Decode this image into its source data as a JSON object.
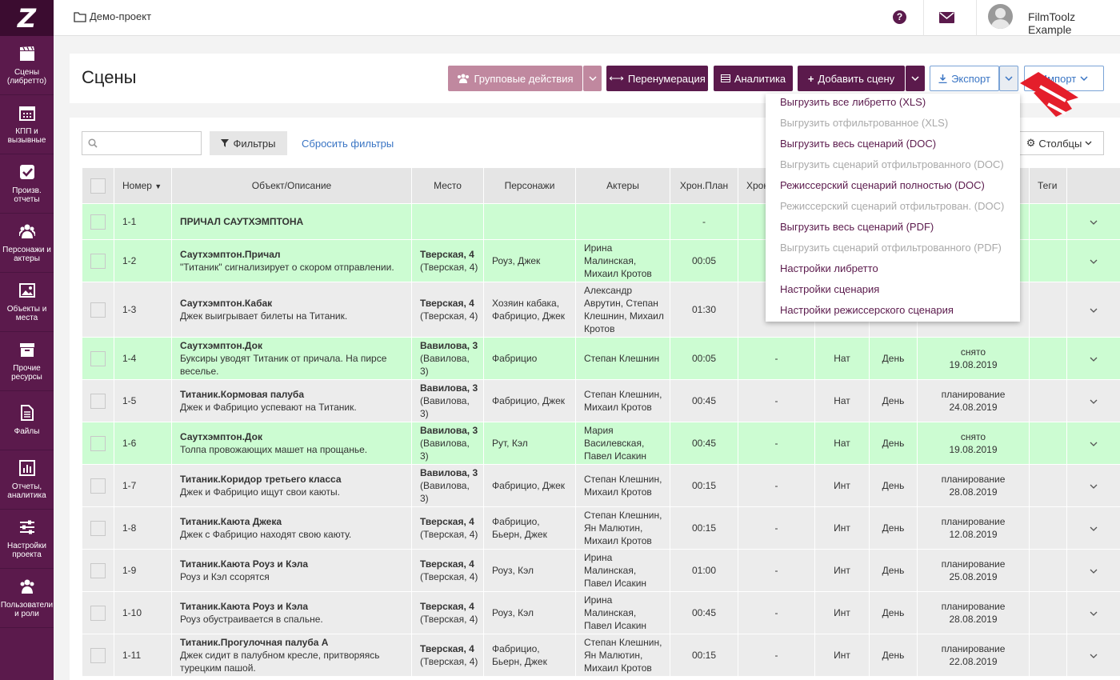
{
  "app": {
    "logo": "Z"
  },
  "sidebar": {
    "items": [
      {
        "label": "Сцены (либретто)",
        "icon": "clapperboard-icon"
      },
      {
        "label": "КПП и вызывные",
        "icon": "calendar-icon"
      },
      {
        "label": "Произв. отчеты",
        "icon": "checkbox-icon"
      },
      {
        "label": "Персонажи и актеры",
        "icon": "people-icon"
      },
      {
        "label": "Объекты и места",
        "icon": "image-icon"
      },
      {
        "label": "Прочие ресурсы",
        "icon": "archive-icon"
      },
      {
        "label": "Файлы",
        "icon": "file-icon"
      },
      {
        "label": "Отчеты, аналитика",
        "icon": "bar-chart-icon"
      },
      {
        "label": "Настройки проекта",
        "icon": "sliders-icon"
      },
      {
        "label": "Пользователи и роли",
        "icon": "users-icon"
      }
    ]
  },
  "topbar": {
    "project": "Демо-проект",
    "help": "?",
    "user": "FilmToolz Example"
  },
  "header": {
    "title": "Сцены",
    "group_actions": "Групповые действия",
    "renumber": "Перенумерация",
    "analytics": "Аналитика",
    "add_scene": "Добавить сцену",
    "export": "Экспорт",
    "import": "Импорт"
  },
  "toolbar": {
    "filters": "Фильтры",
    "reset": "Сбросить фильтры",
    "columns": "Столбцы"
  },
  "table": {
    "headers": {
      "num": "Номер",
      "obj": "Объект/Описание",
      "place": "Место",
      "chars": "Персонажи",
      "actors": "Актеры",
      "chron": "Хрон.План",
      "chron2": "Хрон",
      "tags": "Теги"
    },
    "rows": [
      {
        "num": "1-1",
        "title": "ПРИЧАЛ САУТХЭМПТОНА",
        "desc": "",
        "place_b": "",
        "place": "",
        "chars": "",
        "actors": "",
        "chron": "-",
        "chron2": "",
        "it": "",
        "dn": "",
        "status": "",
        "date": "",
        "green": true
      },
      {
        "num": "1-2",
        "title": "Саутхэмптон.Причал",
        "desc": "\"Титаник\" сигнализирует о скором отправлении.",
        "place_b": "Тверская, 4",
        "place": "(Тверская, 4)",
        "chars": "Роуз, Джек",
        "actors": "Ирина Малинская, Михаил Кротов",
        "chron": "00:05",
        "chron2": "",
        "it": "",
        "dn": "",
        "status": "",
        "date": "",
        "green": true
      },
      {
        "num": "1-3",
        "title": "Саутхэмптон.Кабак",
        "desc": "Джек выигрывает билеты на Титаник.",
        "place_b": "Тверская, 4",
        "place": "(Тверская, 4)",
        "chars": "Хозяин кабака, Фабрицио, Джек",
        "actors": "Александр Аврутин, Степан Клешнин, Михаил Кротов",
        "chron": "01:30",
        "chron2": "",
        "it": "",
        "dn": "",
        "status": "",
        "date": "",
        "green": false
      },
      {
        "num": "1-4",
        "title": "Саутхэмптон.Док",
        "desc": "Буксиры уводят Титаник от причала. На пирсе веселье.",
        "place_b": "Вавилова, 3",
        "place": "(Вавилова, 3)",
        "chars": "Фабрицио",
        "actors": "Степан Клешнин",
        "chron": "00:05",
        "chron2": "-",
        "it": "Нат",
        "dn": "День",
        "status": "снято",
        "date": "19.08.2019",
        "green": true
      },
      {
        "num": "1-5",
        "title": "Титаник.Кормовая палуба",
        "desc": "Джек и Фабрицио успевают на Титаник.",
        "place_b": "Вавилова, 3",
        "place": "(Вавилова, 3)",
        "chars": "Фабрицио, Джек",
        "actors": "Степан Клешнин, Михаил Кротов",
        "chron": "00:45",
        "chron2": "-",
        "it": "Нат",
        "dn": "День",
        "status": "планирование",
        "date": "24.08.2019",
        "green": false
      },
      {
        "num": "1-6",
        "title": "Саутхэмптон.Док",
        "desc": "Толпа провожающих машет на прощанье.",
        "place_b": "Вавилова, 3",
        "place": "(Вавилова, 3)",
        "chars": "Рут, Кэл",
        "actors": "Мария Василевская, Павел Исакин",
        "chron": "00:45",
        "chron2": "-",
        "it": "Нат",
        "dn": "День",
        "status": "снято",
        "date": "19.08.2019",
        "green": true
      },
      {
        "num": "1-7",
        "title": "Титаник.Коридор третьего класса",
        "desc": "Джек и Фабрицио ищут свои каюты.",
        "place_b": "Вавилова, 3",
        "place": "(Вавилова, 3)",
        "chars": "Фабрицио, Джек",
        "actors": "Степан Клешнин, Михаил Кротов",
        "chron": "00:15",
        "chron2": "-",
        "it": "Инт",
        "dn": "День",
        "status": "планирование",
        "date": "28.08.2019",
        "green": false
      },
      {
        "num": "1-8",
        "title": "Титаник.Каюта Джека",
        "desc": "Джек с Фабрицио находят свою каюту.",
        "place_b": "Тверская, 4",
        "place": "(Тверская, 4)",
        "chars": "Фабрицио, Бьерн, Джек",
        "actors": "Степан Клешнин, Ян Малютин, Михаил Кротов",
        "chron": "00:15",
        "chron2": "-",
        "it": "Инт",
        "dn": "День",
        "status": "планирование",
        "date": "12.08.2019",
        "green": false
      },
      {
        "num": "1-9",
        "title": "Титаник.Каюта Роуз и Кэла",
        "desc": "Роуз и Кэл ссорятся",
        "place_b": "Тверская, 4",
        "place": "(Тверская, 4)",
        "chars": "Роуз, Кэл",
        "actors": "Ирина Малинская, Павел Исакин",
        "chron": "01:00",
        "chron2": "-",
        "it": "Инт",
        "dn": "День",
        "status": "планирование",
        "date": "25.08.2019",
        "green": false
      },
      {
        "num": "1-10",
        "title": "Титаник.Каюта Роуз и Кэла",
        "desc": "Роуз обустраивается в спальне.",
        "place_b": "Тверская, 4",
        "place": "(Тверская, 4)",
        "chars": "Роуз, Кэл",
        "actors": "Ирина Малинская, Павел Исакин",
        "chron": "00:45",
        "chron2": "-",
        "it": "Инт",
        "dn": "День",
        "status": "планирование",
        "date": "28.08.2019",
        "green": false
      },
      {
        "num": "1-11",
        "title": "Титаник.Прогулочная палуба A",
        "desc": "Джек сидит в палубном кресле, притворяясь турецким пашой.",
        "place_b": "Тверская, 4",
        "place": "(Тверская, 4)",
        "chars": "Фабрицио, Бьерн, Джек",
        "actors": "Степан Клешнин, Ян Малютин, Михаил Кротов",
        "chron": "00:15",
        "chron2": "-",
        "it": "Инт",
        "dn": "День",
        "status": "планирование",
        "date": "22.08.2019",
        "green": false
      }
    ]
  },
  "export_menu": {
    "items": [
      {
        "label": "Выгрузить все либретто (XLS)",
        "enabled": true
      },
      {
        "label": "Выгрузить отфильтрованное (XLS)",
        "enabled": false
      },
      {
        "label": "Выгрузить весь сценарий (DOC)",
        "enabled": true
      },
      {
        "label": "Выгрузить сценарий отфильтрованного (DOC)",
        "enabled": false
      },
      {
        "label": "Режиссерский сценарий полностью (DOC)",
        "enabled": true
      },
      {
        "label": "Режиссерский сценарий отфильтрован. (DOC)",
        "enabled": false
      },
      {
        "label": "Выгрузить весь сценарий (PDF)",
        "enabled": true
      },
      {
        "label": "Выгрузить сценарий отфильтрованного (PDF)",
        "enabled": false
      },
      {
        "label": "Настройки либретто",
        "enabled": true
      },
      {
        "label": "Настройки сценария",
        "enabled": true
      },
      {
        "label": "Настройки режиссерского сценария",
        "enabled": true
      }
    ]
  },
  "colors": {
    "brand": "#5b1a4c",
    "green_row": "#ccfcd2",
    "link": "#3a75c4",
    "annotation_arrow": "#e41e2b"
  }
}
